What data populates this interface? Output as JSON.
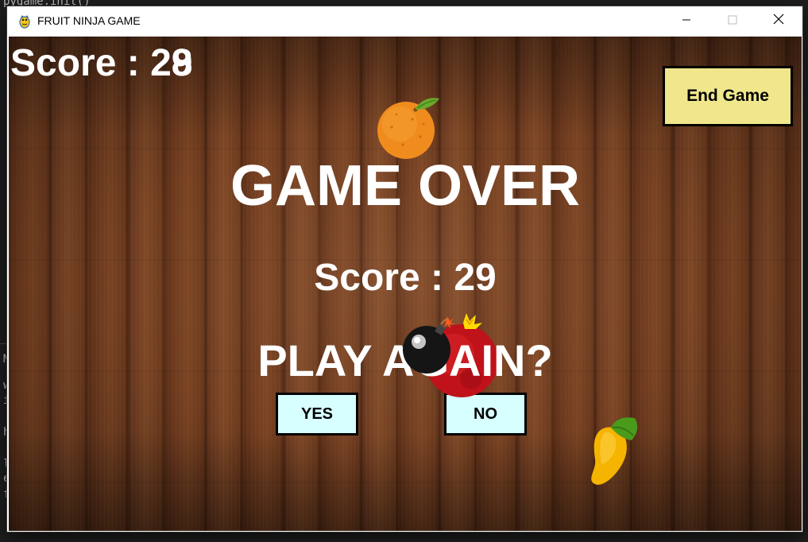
{
  "background_editor": {
    "lines": [
      "pygame.init()",
      "M",
      "ws",
      "ig",
      "he",
      "lu",
      "e",
      "f"
    ]
  },
  "window": {
    "title": "FRUIT NINJA GAME",
    "icon": "pygame-snake-icon",
    "controls": {
      "minimize_icon": "minimize-icon",
      "maximize_icon": "maximize-icon",
      "close_icon": "close-icon"
    }
  },
  "game": {
    "score_label_top": "Score : 2",
    "score_digit_overlap_a": "8",
    "score_digit_overlap_b": "9",
    "end_game_label": "End Game",
    "game_over_title": "GAME OVER",
    "final_score_text": "Score : 29",
    "play_again_prompt": "PLAY AGAIN?",
    "yes_label": "YES",
    "no_label": "NO",
    "sprites": [
      "orange",
      "pomegranate",
      "bomb",
      "mango"
    ]
  },
  "colors": {
    "end_game_bg": "#f0e68c",
    "choice_bg": "#d8ffff",
    "text": "#ffffff",
    "wood": "#6e3a1e"
  }
}
